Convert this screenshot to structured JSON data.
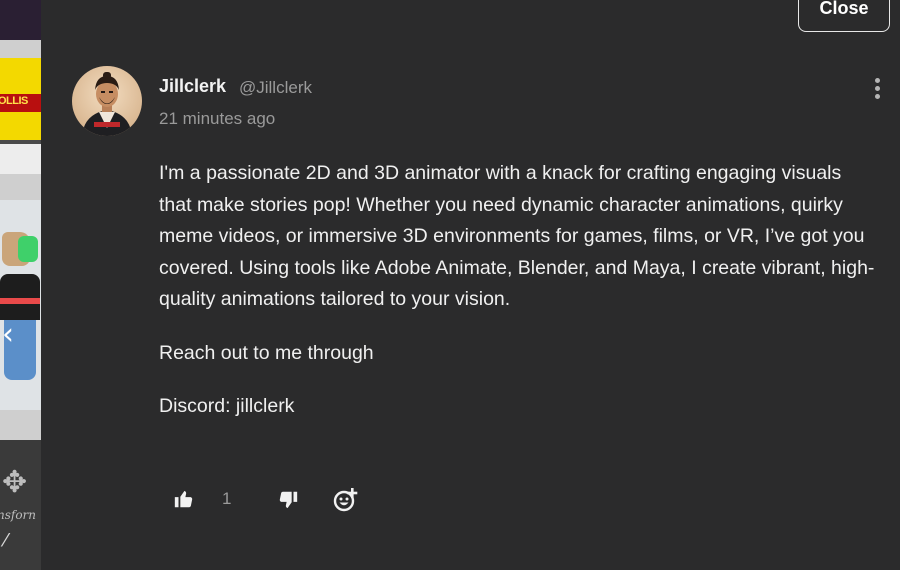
{
  "dialog": {
    "close_label": "Close"
  },
  "post": {
    "username": "Jillclerk",
    "handle": "@Jillclerk",
    "timestamp": "21 minutes ago",
    "paragraphs": [
      "I'm a passionate 2D and 3D animator with a knack for crafting engaging visuals that make stories pop! Whether you need dynamic character animations, quirky meme videos, or immersive 3D environments for games, films, or VR, I’ve got you covered. Using tools like Adobe Animate, Blender, and Maya, I create vibrant, high-quality animations tailored to your vision.",
      "Reach out to me through",
      "Discord: jillclerk"
    ],
    "like_count": "1"
  },
  "background": {
    "thumb_text": "OLLIS",
    "tool_label": "nsforn"
  },
  "icons": {
    "more": "more-vertical-icon",
    "like": "thumbs-up-icon",
    "dislike": "thumbs-down-icon",
    "react": "add-reaction-icon"
  },
  "colors": {
    "panel_bg": "#2b2b2c",
    "text": "#f0f0f0",
    "muted": "#9a9a9a"
  }
}
